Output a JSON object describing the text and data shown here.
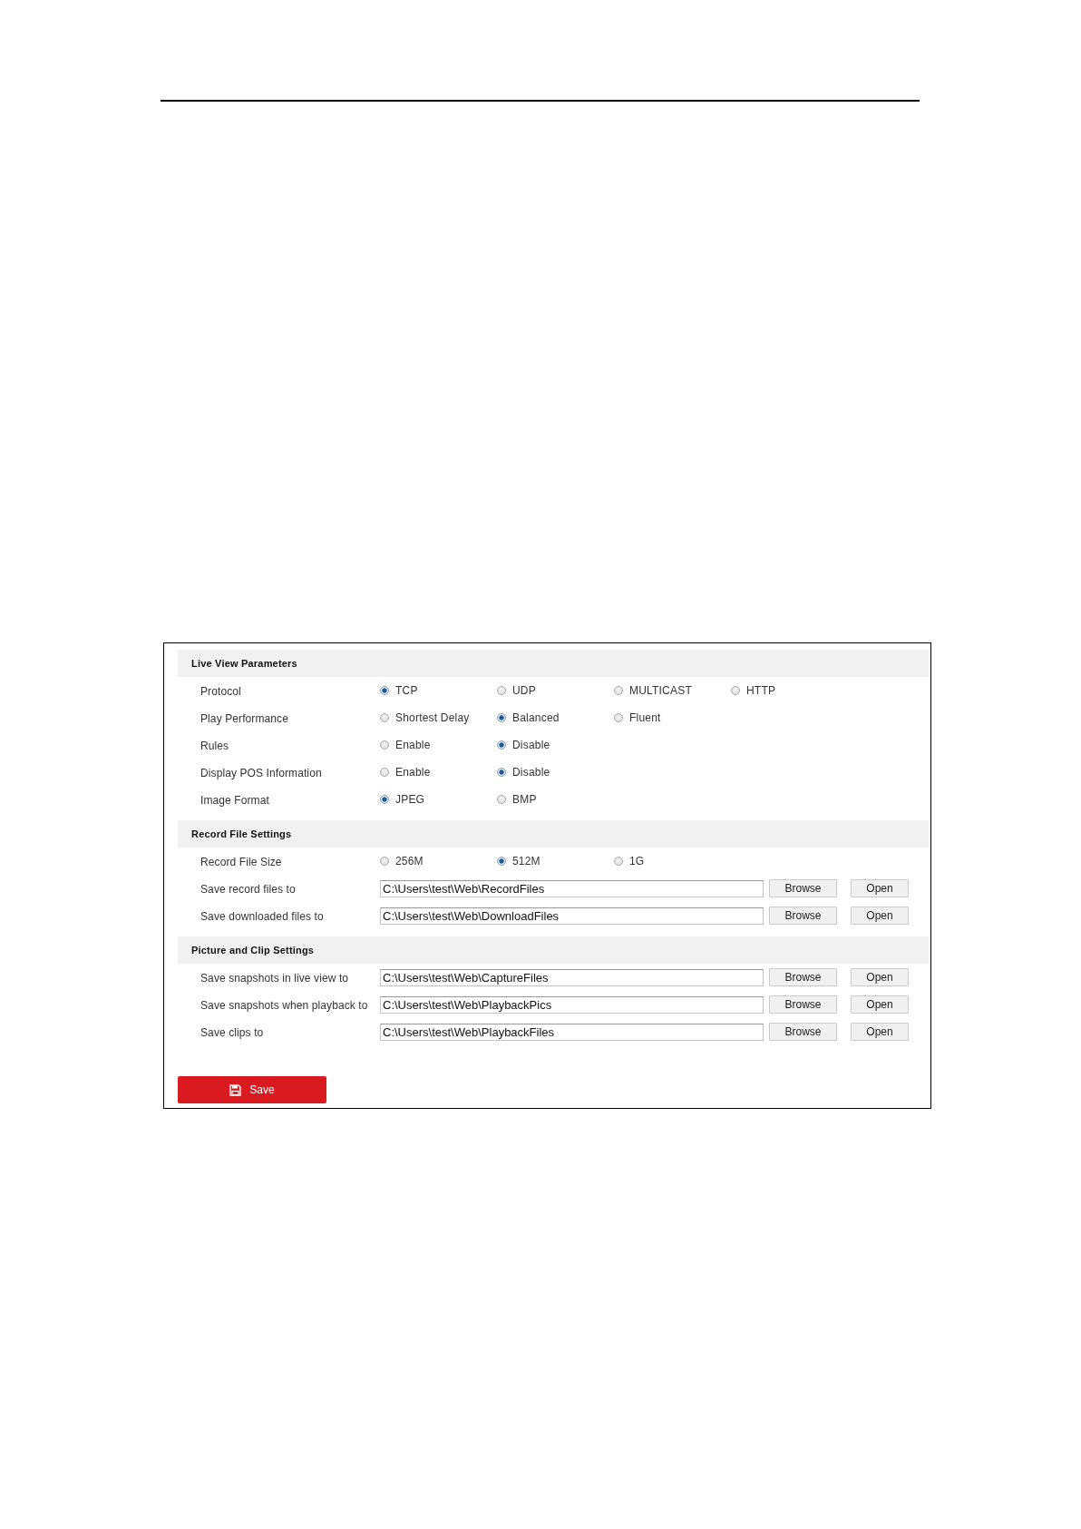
{
  "sections": [
    {
      "title": "Live View Parameters",
      "rows": [
        {
          "kind": "radio",
          "label": "Protocol",
          "options": [
            {
              "label": "TCP",
              "selected": true
            },
            {
              "label": "UDP",
              "selected": false
            },
            {
              "label": "MULTICAST",
              "selected": false
            },
            {
              "label": "HTTP",
              "selected": false
            }
          ]
        },
        {
          "kind": "radio",
          "label": "Play Performance",
          "options": [
            {
              "label": "Shortest Delay",
              "selected": false
            },
            {
              "label": "Balanced",
              "selected": true
            },
            {
              "label": "Fluent",
              "selected": false
            }
          ]
        },
        {
          "kind": "radio",
          "label": "Rules",
          "options": [
            {
              "label": "Enable",
              "selected": false
            },
            {
              "label": "Disable",
              "selected": true
            }
          ]
        },
        {
          "kind": "radio",
          "label": "Display POS Information",
          "options": [
            {
              "label": "Enable",
              "selected": false
            },
            {
              "label": "Disable",
              "selected": true
            }
          ]
        },
        {
          "kind": "radio",
          "label": "Image Format",
          "options": [
            {
              "label": "JPEG",
              "selected": true
            },
            {
              "label": "BMP",
              "selected": false
            }
          ]
        }
      ]
    },
    {
      "title": "Record File Settings",
      "rows": [
        {
          "kind": "radio",
          "label": "Record File Size",
          "options": [
            {
              "label": "256M",
              "selected": false
            },
            {
              "label": "512M",
              "selected": true
            },
            {
              "label": "1G",
              "selected": false
            }
          ]
        },
        {
          "kind": "path",
          "label": "Save record files to",
          "value": "C:\\Users\\test\\Web\\RecordFiles",
          "browse_button": "Browse",
          "open_button": "Open"
        },
        {
          "kind": "path",
          "label": "Save downloaded files to",
          "value": "C:\\Users\\test\\Web\\DownloadFiles",
          "browse_button": "Browse",
          "open_button": "Open"
        }
      ]
    },
    {
      "title": "Picture and Clip Settings",
      "rows": [
        {
          "kind": "path",
          "label": "Save snapshots in live view to",
          "value": "C:\\Users\\test\\Web\\CaptureFiles",
          "browse_button": "Browse",
          "open_button": "Open"
        },
        {
          "kind": "path",
          "label": "Save snapshots when playback to",
          "value": "C:\\Users\\test\\Web\\PlaybackPics",
          "browse_button": "Browse",
          "open_button": "Open"
        },
        {
          "kind": "path",
          "label": "Save clips to",
          "value": "C:\\Users\\test\\Web\\PlaybackFiles",
          "browse_button": "Browse",
          "open_button": "Open"
        }
      ]
    }
  ],
  "save_button": {
    "label": "Save"
  }
}
